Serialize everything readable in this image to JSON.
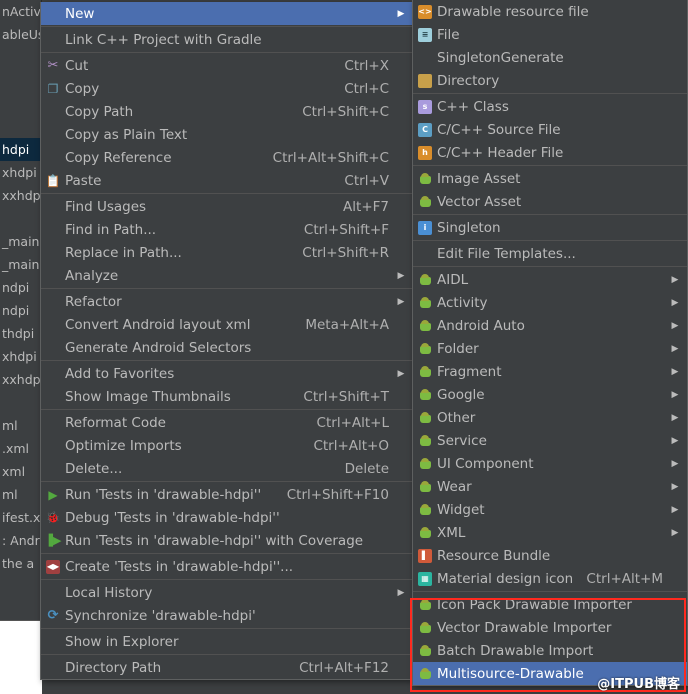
{
  "background": {
    "tree_rows": [
      {
        "label": "nActivi",
        "selected": false
      },
      {
        "label": "ableUs",
        "selected": false
      },
      {
        "label": "",
        "selected": false
      },
      {
        "label": "",
        "selected": false
      },
      {
        "label": "",
        "selected": false
      },
      {
        "label": "",
        "selected": false
      },
      {
        "label": "hdpi",
        "selected": true
      },
      {
        "label": "xhdpi",
        "selected": false
      },
      {
        "label": "xxhdp",
        "selected": false
      },
      {
        "label": "",
        "selected": false
      },
      {
        "label": "_main",
        "selected": false
      },
      {
        "label": "_main",
        "selected": false
      },
      {
        "label": "ndpi",
        "selected": false
      },
      {
        "label": "ndpi",
        "selected": false
      },
      {
        "label": "thdpi",
        "selected": false
      },
      {
        "label": "xhdpi",
        "selected": false
      },
      {
        "label": "xxhdp",
        "selected": false
      },
      {
        "label": "",
        "selected": false
      },
      {
        "label": "ml",
        "selected": false
      },
      {
        "label": ".xml",
        "selected": false
      },
      {
        "label": "xml",
        "selected": false
      },
      {
        "label": "ml",
        "selected": false
      },
      {
        "label": "ifest.x",
        "selected": false
      },
      {
        "label": ": Andr",
        "selected": false
      },
      {
        "label": "the a",
        "selected": false
      }
    ]
  },
  "context_menu": {
    "items": [
      {
        "type": "item",
        "icon": "none",
        "label": "New",
        "accel": "",
        "arrow": true,
        "selected": true,
        "underline": ""
      },
      {
        "type": "sep"
      },
      {
        "type": "item",
        "icon": "none",
        "label": "Link C++ Project with Gradle",
        "accel": "",
        "arrow": false,
        "selected": false,
        "underline": ""
      },
      {
        "type": "sep"
      },
      {
        "type": "item",
        "icon": "scissors-icon",
        "label": "Cut",
        "accel": "Ctrl+X",
        "arrow": false,
        "selected": false,
        "underline": "t"
      },
      {
        "type": "item",
        "icon": "copy-icon",
        "label": "Copy",
        "accel": "Ctrl+C",
        "arrow": false,
        "selected": false,
        "underline": "C"
      },
      {
        "type": "item",
        "icon": "none",
        "label": "Copy Path",
        "accel": "Ctrl+Shift+C",
        "arrow": false,
        "selected": false,
        "underline": "o"
      },
      {
        "type": "item",
        "icon": "none",
        "label": "Copy as Plain Text",
        "accel": "",
        "arrow": false,
        "selected": false,
        "underline": ""
      },
      {
        "type": "item",
        "icon": "none",
        "label": "Copy Reference",
        "accel": "Ctrl+Alt+Shift+C",
        "arrow": false,
        "selected": false,
        "underline": "y"
      },
      {
        "type": "item",
        "icon": "paste-icon",
        "label": "Paste",
        "accel": "Ctrl+V",
        "arrow": false,
        "selected": false,
        "underline": "P"
      },
      {
        "type": "sep"
      },
      {
        "type": "item",
        "icon": "none",
        "label": "Find Usages",
        "accel": "Alt+F7",
        "arrow": false,
        "selected": false,
        "underline": "U"
      },
      {
        "type": "item",
        "icon": "none",
        "label": "Find in Path...",
        "accel": "Ctrl+Shift+F",
        "arrow": false,
        "selected": false,
        "underline": "P"
      },
      {
        "type": "item",
        "icon": "none",
        "label": "Replace in Path...",
        "accel": "Ctrl+Shift+R",
        "arrow": false,
        "selected": false,
        "underline": "a"
      },
      {
        "type": "item",
        "icon": "none",
        "label": "Analyze",
        "accel": "",
        "arrow": true,
        "selected": false,
        "underline": "z"
      },
      {
        "type": "sep"
      },
      {
        "type": "item",
        "icon": "none",
        "label": "Refactor",
        "accel": "",
        "arrow": true,
        "selected": false,
        "underline": "R"
      },
      {
        "type": "item",
        "icon": "none",
        "label": "Convert Android layout xml",
        "accel": "Meta+Alt+A",
        "arrow": false,
        "selected": false,
        "underline": ""
      },
      {
        "type": "item",
        "icon": "none",
        "label": "Generate Android Selectors",
        "accel": "",
        "arrow": false,
        "selected": false,
        "underline": ""
      },
      {
        "type": "sep"
      },
      {
        "type": "item",
        "icon": "none",
        "label": "Add to Favorites",
        "accel": "",
        "arrow": true,
        "selected": false,
        "underline": "F"
      },
      {
        "type": "item",
        "icon": "none",
        "label": "Show Image Thumbnails",
        "accel": "Ctrl+Shift+T",
        "arrow": false,
        "selected": false,
        "underline": ""
      },
      {
        "type": "sep"
      },
      {
        "type": "item",
        "icon": "none",
        "label": "Reformat Code",
        "accel": "Ctrl+Alt+L",
        "arrow": false,
        "selected": false,
        "underline": "R"
      },
      {
        "type": "item",
        "icon": "none",
        "label": "Optimize Imports",
        "accel": "Ctrl+Alt+O",
        "arrow": false,
        "selected": false,
        "underline": "z"
      },
      {
        "type": "item",
        "icon": "none",
        "label": "Delete...",
        "accel": "Delete",
        "arrow": false,
        "selected": false,
        "underline": "D"
      },
      {
        "type": "sep"
      },
      {
        "type": "item",
        "icon": "run-icon",
        "label": "Run 'Tests in 'drawable-hdpi''",
        "accel": "Ctrl+Shift+F10",
        "arrow": false,
        "selected": false,
        "underline": "u"
      },
      {
        "type": "item",
        "icon": "debug-icon",
        "label": "Debug 'Tests in 'drawable-hdpi''",
        "accel": "",
        "arrow": false,
        "selected": false,
        "underline": "D"
      },
      {
        "type": "item",
        "icon": "coverage-icon",
        "label": "Run 'Tests in 'drawable-hdpi'' with Coverage",
        "accel": "",
        "arrow": false,
        "selected": false,
        "underline": "v"
      },
      {
        "type": "sep"
      },
      {
        "type": "item",
        "icon": "create-icon",
        "label": "Create 'Tests in 'drawable-hdpi''...",
        "accel": "",
        "arrow": false,
        "selected": false,
        "underline": ""
      },
      {
        "type": "sep"
      },
      {
        "type": "item",
        "icon": "none",
        "label": "Local History",
        "accel": "",
        "arrow": true,
        "selected": false,
        "underline": "H"
      },
      {
        "type": "item",
        "icon": "sync-icon",
        "label": "Synchronize 'drawable-hdpi'",
        "accel": "",
        "arrow": false,
        "selected": false,
        "underline": ""
      },
      {
        "type": "sep"
      },
      {
        "type": "item",
        "icon": "none",
        "label": "Show in Explorer",
        "accel": "",
        "arrow": false,
        "selected": false,
        "underline": ""
      },
      {
        "type": "sep"
      },
      {
        "type": "item",
        "icon": "none",
        "label": "Directory Path",
        "accel": "Ctrl+Alt+F12",
        "arrow": false,
        "selected": false,
        "underline": "P"
      }
    ]
  },
  "submenu": {
    "items": [
      {
        "type": "item",
        "icon": "drawable-resource-icon",
        "label": "Drawable resource file",
        "accel": "",
        "arrow": false,
        "selected": false
      },
      {
        "type": "item",
        "icon": "file-icon",
        "label": "File",
        "accel": "",
        "arrow": false,
        "selected": false
      },
      {
        "type": "item",
        "icon": "none",
        "label": "SingletonGenerate",
        "accel": "",
        "arrow": false,
        "selected": false
      },
      {
        "type": "item",
        "icon": "directory-icon",
        "label": "Directory",
        "accel": "",
        "arrow": false,
        "selected": false
      },
      {
        "type": "sep"
      },
      {
        "type": "item",
        "icon": "cpp-class-icon",
        "label": "C++ Class",
        "accel": "",
        "arrow": false,
        "selected": false
      },
      {
        "type": "item",
        "icon": "cpp-source-icon",
        "label": "C/C++ Source File",
        "accel": "",
        "arrow": false,
        "selected": false
      },
      {
        "type": "item",
        "icon": "cpp-header-icon",
        "label": "C/C++ Header File",
        "accel": "",
        "arrow": false,
        "selected": false
      },
      {
        "type": "sep"
      },
      {
        "type": "item",
        "icon": "android-icon",
        "label": "Image Asset",
        "accel": "",
        "arrow": false,
        "selected": false
      },
      {
        "type": "item",
        "icon": "android-icon",
        "label": "Vector Asset",
        "accel": "",
        "arrow": false,
        "selected": false
      },
      {
        "type": "sep"
      },
      {
        "type": "item",
        "icon": "singleton-icon",
        "label": "Singleton",
        "accel": "",
        "arrow": false,
        "selected": false
      },
      {
        "type": "sep"
      },
      {
        "type": "item",
        "icon": "none",
        "label": "Edit File Templates...",
        "accel": "",
        "arrow": false,
        "selected": false
      },
      {
        "type": "sep"
      },
      {
        "type": "item",
        "icon": "android-icon",
        "label": "AIDL",
        "accel": "",
        "arrow": true,
        "selected": false
      },
      {
        "type": "item",
        "icon": "android-icon",
        "label": "Activity",
        "accel": "",
        "arrow": true,
        "selected": false
      },
      {
        "type": "item",
        "icon": "android-icon",
        "label": "Android Auto",
        "accel": "",
        "arrow": true,
        "selected": false
      },
      {
        "type": "item",
        "icon": "android-icon",
        "label": "Folder",
        "accel": "",
        "arrow": true,
        "selected": false
      },
      {
        "type": "item",
        "icon": "android-icon",
        "label": "Fragment",
        "accel": "",
        "arrow": true,
        "selected": false
      },
      {
        "type": "item",
        "icon": "android-icon",
        "label": "Google",
        "accel": "",
        "arrow": true,
        "selected": false
      },
      {
        "type": "item",
        "icon": "android-icon",
        "label": "Other",
        "accel": "",
        "arrow": true,
        "selected": false
      },
      {
        "type": "item",
        "icon": "android-icon",
        "label": "Service",
        "accel": "",
        "arrow": true,
        "selected": false
      },
      {
        "type": "item",
        "icon": "android-icon",
        "label": "UI Component",
        "accel": "",
        "arrow": true,
        "selected": false
      },
      {
        "type": "item",
        "icon": "android-icon",
        "label": "Wear",
        "accel": "",
        "arrow": true,
        "selected": false
      },
      {
        "type": "item",
        "icon": "android-icon",
        "label": "Widget",
        "accel": "",
        "arrow": true,
        "selected": false
      },
      {
        "type": "item",
        "icon": "android-icon",
        "label": "XML",
        "accel": "",
        "arrow": true,
        "selected": false
      },
      {
        "type": "item",
        "icon": "resource-bundle-icon",
        "label": "Resource Bundle",
        "accel": "",
        "arrow": false,
        "selected": false
      },
      {
        "type": "item",
        "icon": "material-icon",
        "label": "Material design icon",
        "accel": "Ctrl+Alt+M",
        "arrow": false,
        "selected": false
      },
      {
        "type": "sep"
      },
      {
        "type": "item",
        "icon": "android-icon",
        "label": "Icon Pack Drawable Importer",
        "accel": "",
        "arrow": false,
        "selected": false
      },
      {
        "type": "item",
        "icon": "android-icon",
        "label": "Vector Drawable Importer",
        "accel": "",
        "arrow": false,
        "selected": false
      },
      {
        "type": "item",
        "icon": "android-icon",
        "label": "Batch Drawable Import",
        "accel": "",
        "arrow": false,
        "selected": false
      },
      {
        "type": "item",
        "icon": "android-icon",
        "label": "Multisource-Drawable",
        "accel": "",
        "arrow": false,
        "selected": true
      }
    ]
  },
  "annotation": {
    "highlight_color": "#ff2a1f",
    "watermark": "@ITPUB博客"
  },
  "colors": {
    "menu_bg": "#3c3f41",
    "menu_text": "#bbbbbb",
    "selection_blue": "#4b6eaf",
    "separator": "#515151",
    "tree_selected": "#0d293e"
  }
}
